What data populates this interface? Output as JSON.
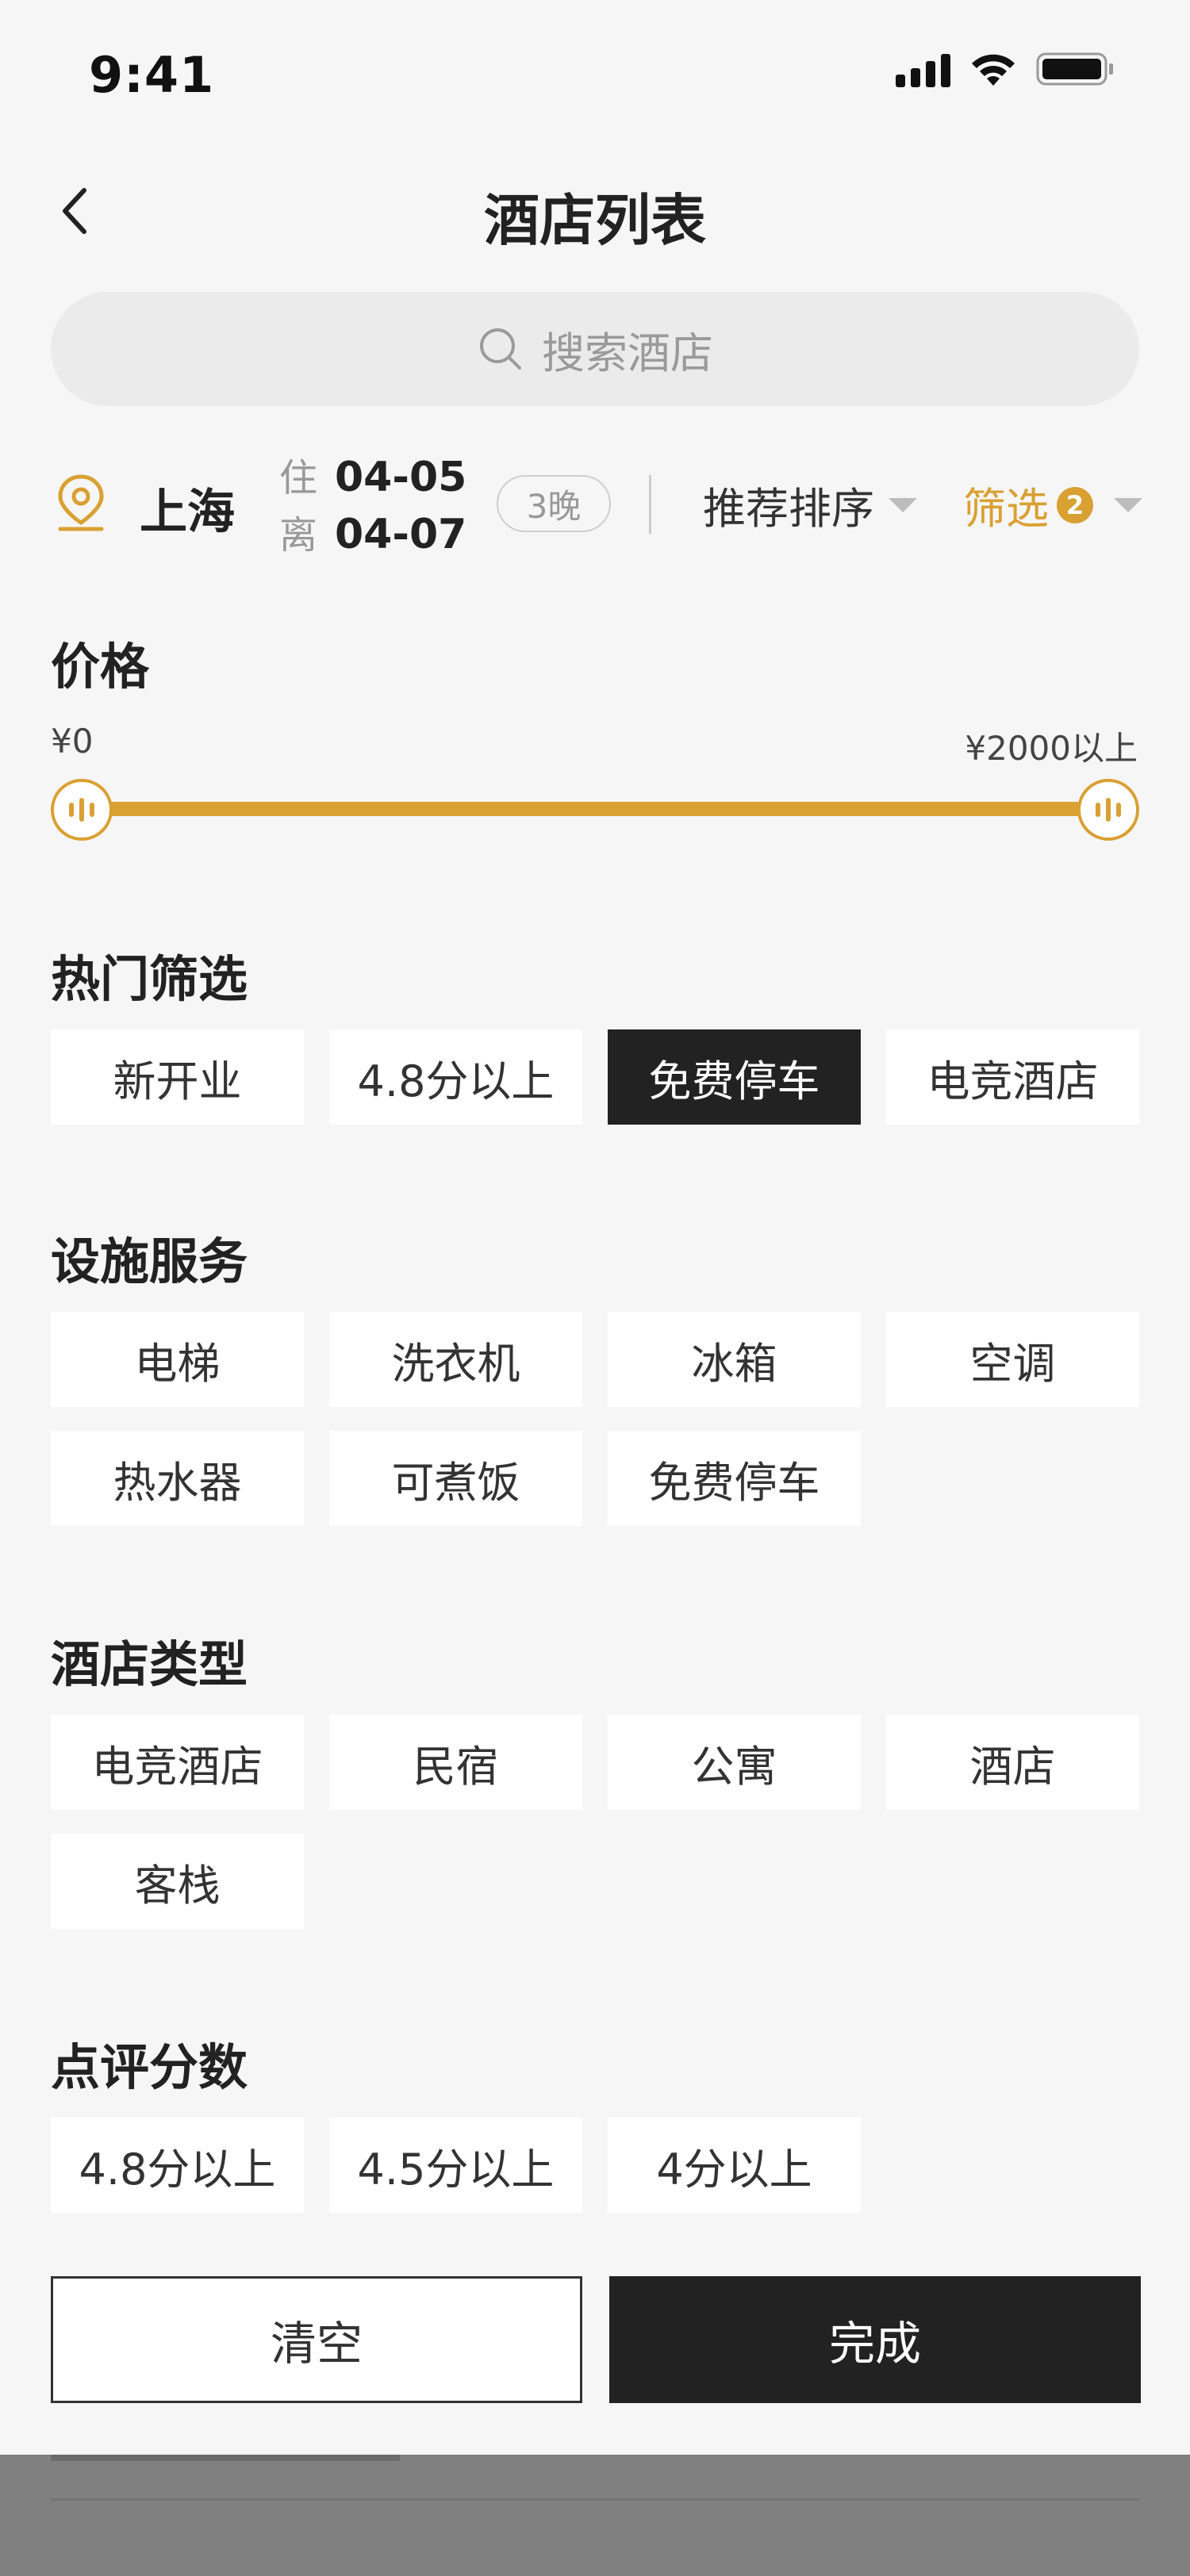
{
  "status_bar": {
    "time": "9:41",
    "icons": [
      "signal-icon",
      "wifi-icon",
      "battery-icon"
    ]
  },
  "nav": {
    "title": "酒店列表",
    "back_icon": "chevron-left-icon"
  },
  "search": {
    "placeholder": "搜索酒店",
    "icon": "search-icon"
  },
  "info_bar": {
    "city": "上海",
    "checkin_label": "住",
    "checkin_date": "04-05",
    "checkout_label": "离",
    "checkout_date": "04-07",
    "nights": "3晚",
    "sort_label": "推荐排序",
    "filter_label": "筛选",
    "filter_count": "2"
  },
  "price": {
    "title": "价格",
    "min_label": "¥0",
    "max_label": "¥2000以上",
    "range_low": 0,
    "range_high": 2000
  },
  "sections": {
    "hot": {
      "title": "热门筛选",
      "items": [
        {
          "label": "新开业",
          "selected": false
        },
        {
          "label": "4.8分以上",
          "selected": false
        },
        {
          "label": "免费停车",
          "selected": true
        },
        {
          "label": "电竞酒店",
          "selected": false
        }
      ]
    },
    "facilities": {
      "title": "设施服务",
      "items": [
        {
          "label": "电梯",
          "selected": false
        },
        {
          "label": "洗衣机",
          "selected": false
        },
        {
          "label": "冰箱",
          "selected": false
        },
        {
          "label": "空调",
          "selected": false
        },
        {
          "label": "热水器",
          "selected": false
        },
        {
          "label": "可煮饭",
          "selected": false
        },
        {
          "label": "免费停车",
          "selected": false
        }
      ]
    },
    "hotel_type": {
      "title": "酒店类型",
      "items": [
        {
          "label": "电竞酒店",
          "selected": false
        },
        {
          "label": "民宿",
          "selected": false
        },
        {
          "label": "公寓",
          "selected": false
        },
        {
          "label": "酒店",
          "selected": false
        },
        {
          "label": "客栈",
          "selected": false
        }
      ]
    },
    "rating": {
      "title": "点评分数",
      "items": [
        {
          "label": "4.8分以上",
          "selected": false
        },
        {
          "label": "4.5分以上",
          "selected": false
        },
        {
          "label": "4分以上",
          "selected": false
        }
      ]
    }
  },
  "actions": {
    "clear_label": "清空",
    "done_label": "完成"
  },
  "colors": {
    "accent": "#d9a032",
    "selected_chip": "#222222",
    "background": "#f6f6f6"
  }
}
